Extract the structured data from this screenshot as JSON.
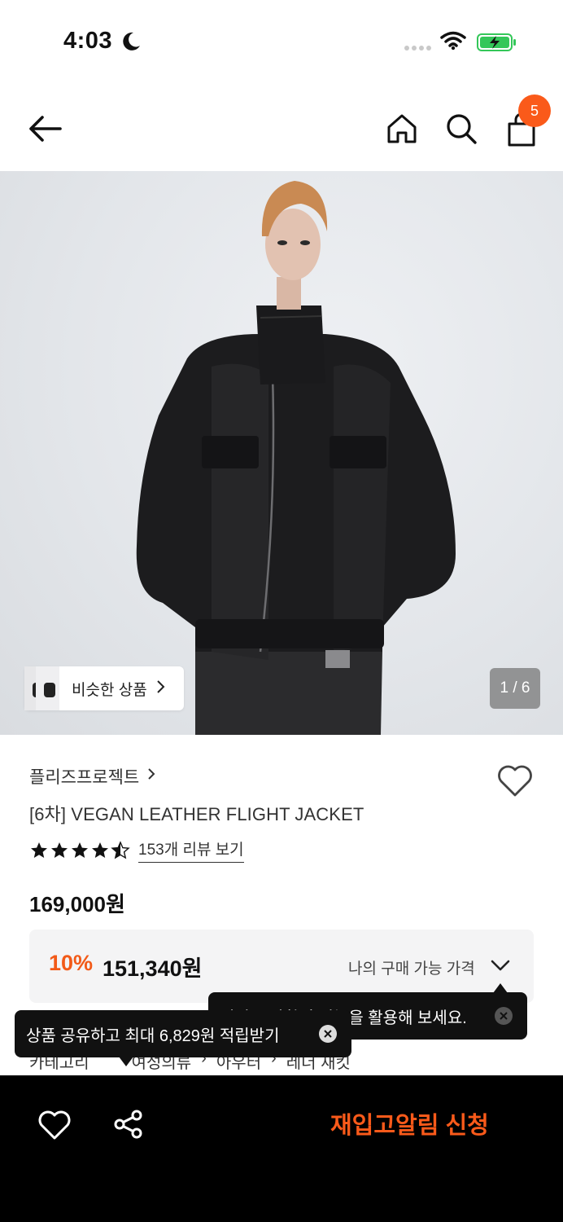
{
  "status_bar": {
    "time": "4:03"
  },
  "nav": {
    "cart_count": "5"
  },
  "hero": {
    "similar_label": "비슷한 상품",
    "page_counter": "1 / 6"
  },
  "product": {
    "brand": "플리즈프로젝트",
    "title": "[6차] VEGAN LEATHER FLIGHT JACKET",
    "rating": 4.5,
    "rating_max": 5,
    "review_link": "153개 리뷰 보기",
    "original_price": "169,000원",
    "discount_rate": "10%",
    "sale_price": "151,340원",
    "my_price_label": "나의 구매 가능 가격"
  },
  "category": {
    "label": "카테고리",
    "path": [
      "여성의류",
      "아우터",
      "레더 재킷"
    ]
  },
  "tooltips": {
    "feature_tip": "컬리드 상황의 기능을 활용해 보세요.",
    "share_tip": "상품 공유하고 최대 6,829원 적립받기"
  },
  "bottom_bar": {
    "restock_label": "재입고알림 신청"
  },
  "colors": {
    "accent": "#fa5a1a",
    "discount": "#f25a18",
    "bottom_bar_bg": "#000000"
  },
  "icons": [
    "moon-icon",
    "wifi-icon",
    "battery-charging-icon",
    "back-arrow-icon",
    "home-icon",
    "search-icon",
    "cart-icon",
    "heart-icon",
    "share-icon",
    "close-icon",
    "chevron-down-icon"
  ]
}
